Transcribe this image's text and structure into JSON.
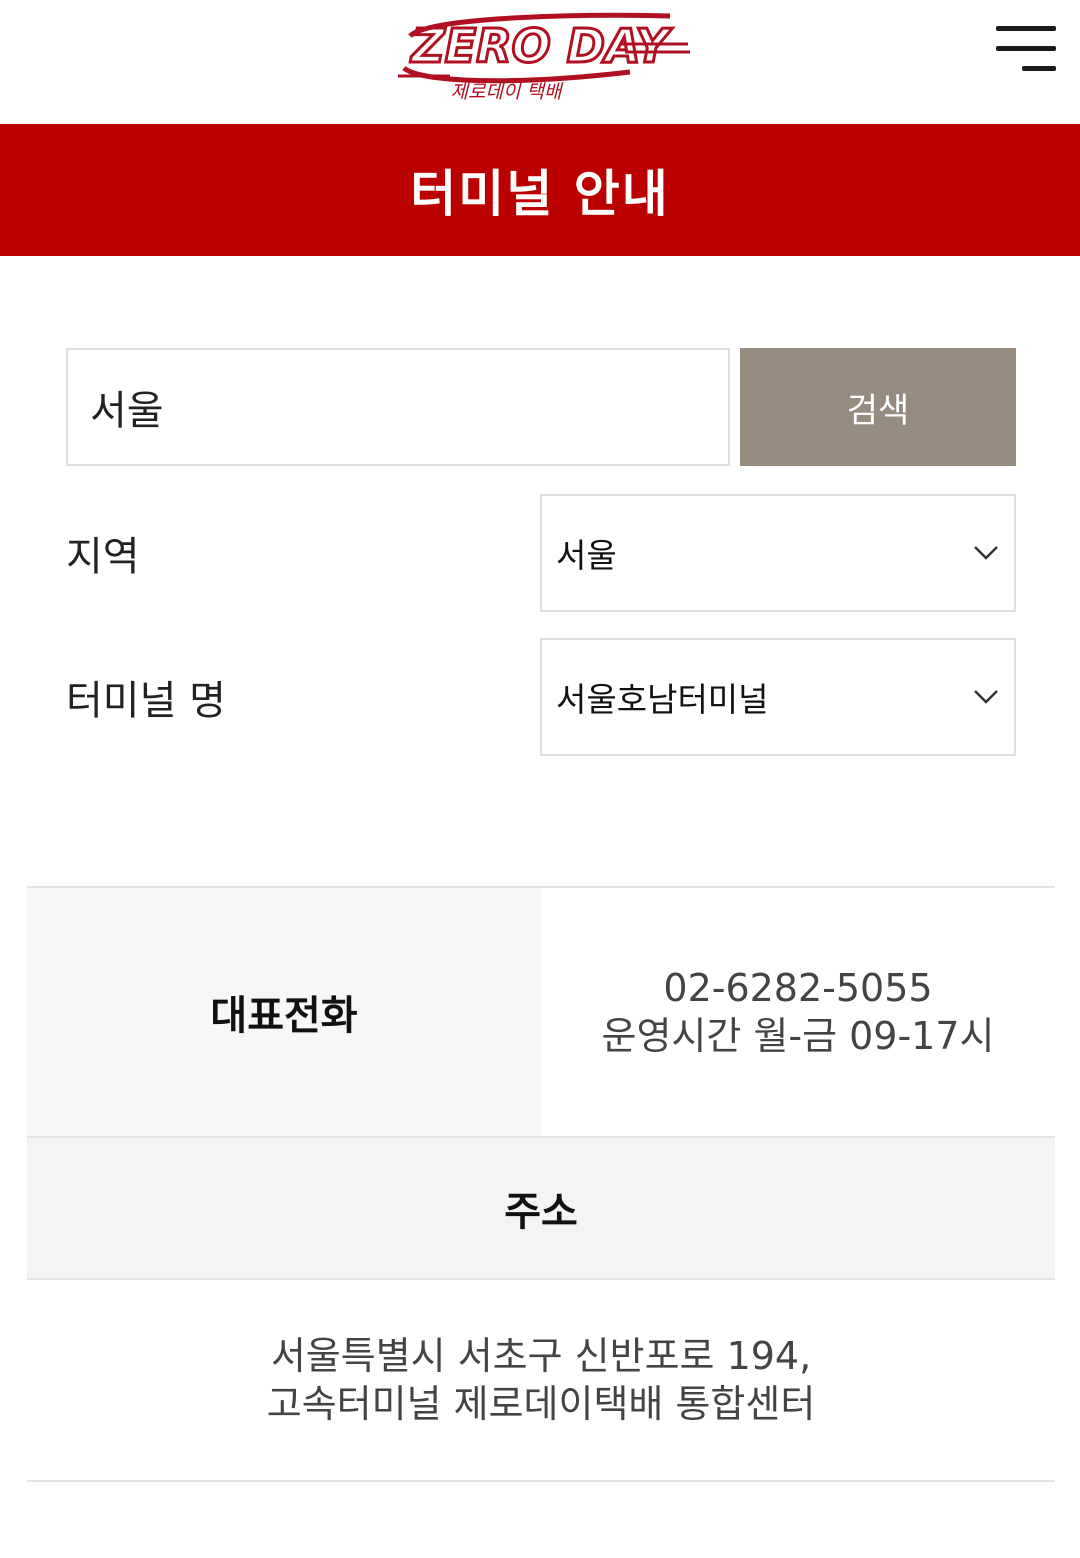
{
  "header": {
    "logo_text": "ZERO DAY",
    "logo_subtext": "제로데이 택배",
    "brand_color": "#bb0000",
    "menu_icon": "hamburger-menu-icon"
  },
  "page": {
    "title": "터미널 안내"
  },
  "search": {
    "value": "서울",
    "button_label": "검색"
  },
  "filters": {
    "region": {
      "label": "지역",
      "selected": "서울",
      "icon": "chevron-down-icon"
    },
    "terminal": {
      "label": "터미널 명",
      "selected": "서울호남터미널",
      "icon": "chevron-down-icon"
    }
  },
  "info": {
    "phone_label": "대표전화",
    "phone_number": "02-6282-5055",
    "phone_hours": "운영시간 월-금 09-17시",
    "address_label": "주소",
    "address_line1": "서울특별시 서초구 신반포로 194,",
    "address_line2": "고속터미널 제로데이택배 통합센터"
  }
}
